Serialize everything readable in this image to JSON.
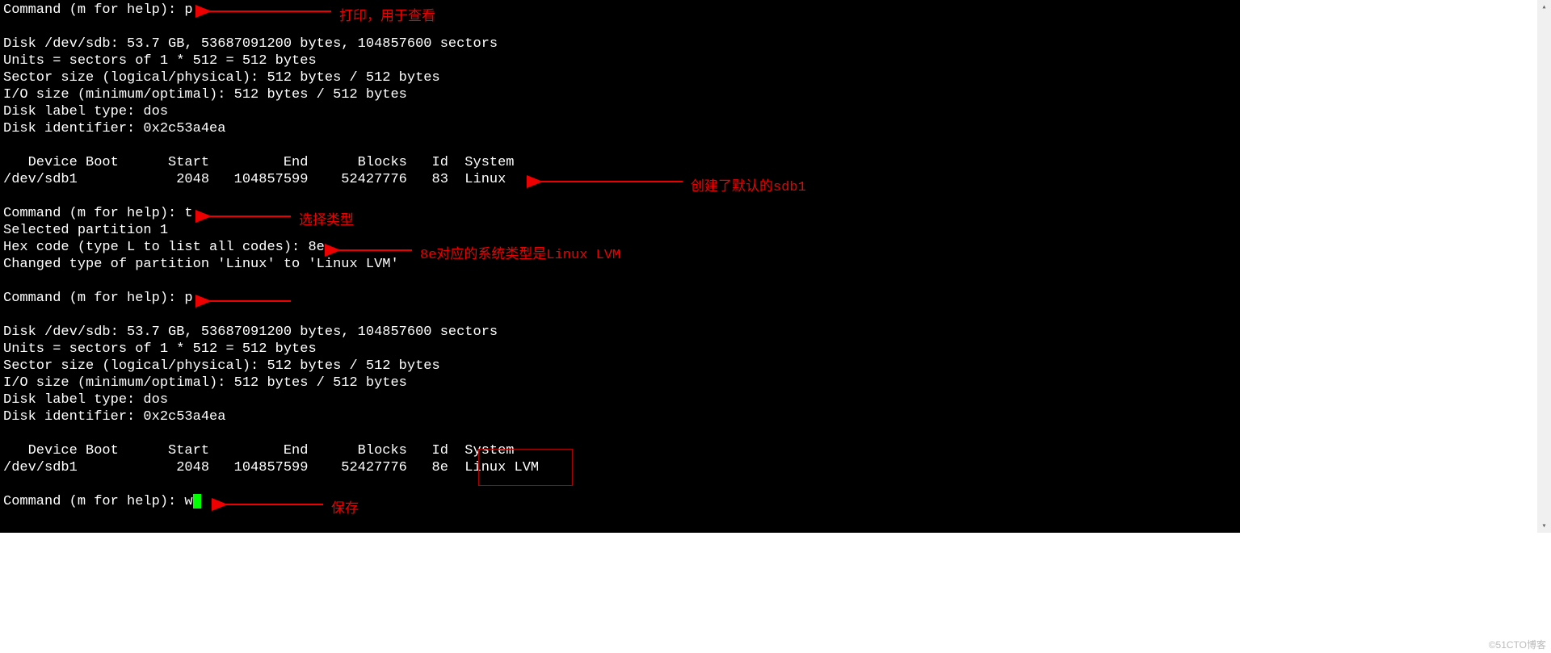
{
  "prompt1": "Command (m for help): p",
  "diskA": [
    "Disk /dev/sdb: 53.7 GB, 53687091200 bytes, 104857600 sectors",
    "Units = sectors of 1 * 512 = 512 bytes",
    "Sector size (logical/physical): 512 bytes / 512 bytes",
    "I/O size (minimum/optimal): 512 bytes / 512 bytes",
    "Disk label type: dos",
    "Disk identifier: 0x2c53a4ea"
  ],
  "tblHdrA": "   Device Boot      Start         End      Blocks   Id  System",
  "tblRowA": "/dev/sdb1            2048   104857599    52427776   83  Linux",
  "prompt2": "Command (m for help): t",
  "selPart": "Selected partition 1",
  "hex": "Hex code (type L to list all codes): 8e",
  "changed": "Changed type of partition 'Linux' to 'Linux LVM'",
  "prompt3": "Command (m for help): p",
  "diskB": [
    "Disk /dev/sdb: 53.7 GB, 53687091200 bytes, 104857600 sectors",
    "Units = sectors of 1 * 512 = 512 bytes",
    "Sector size (logical/physical): 512 bytes / 512 bytes",
    "I/O size (minimum/optimal): 512 bytes / 512 bytes",
    "Disk label type: dos",
    "Disk identifier: 0x2c53a4ea"
  ],
  "tblHdrB": "   Device Boot      Start         End      Blocks   Id  System",
  "tblRowB": "/dev/sdb1            2048   104857599    52427776   8e  Linux LVM",
  "prompt4": "Command (m for help): w",
  "anno": {
    "print": "打印，用于查看",
    "created": "创建了默认的sdb1",
    "selType": "选择类型",
    "lvm": "8e对应的系统类型是Linux LVM",
    "save": "保存"
  },
  "watermark": "©51CTO博客"
}
